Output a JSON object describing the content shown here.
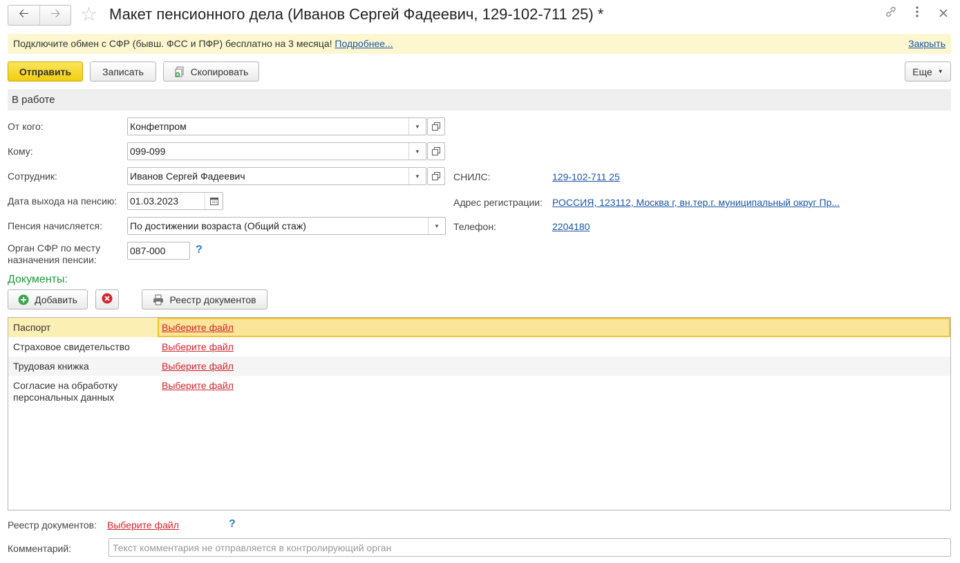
{
  "window": {
    "title": "Макет пенсионного дела (Иванов Сергей Фадеевич, 129-102-711 25) *",
    "back_icon": "arrow-left",
    "forward_icon": "arrow-right",
    "favorite_icon": "star",
    "link_icon": "link",
    "more_icon": "vertical-dots",
    "close_icon": "close"
  },
  "banner": {
    "text": "Подключите обмен с СФР (бывш. ФСС и ПФР) бесплатно на 3 месяца!",
    "more_link": "Подробнее...",
    "close_link": "Закрыть",
    "background": "#fcf7cf"
  },
  "toolbar": {
    "send_label": "Отправить",
    "save_label": "Записать",
    "copy_label": "Скопировать",
    "more_label": "Еще"
  },
  "status": "В работе",
  "form": {
    "from_label": "От кого:",
    "from_value": "Конфетпром",
    "to_label": "Кому:",
    "to_value": "099-099",
    "employee_label": "Сотрудник:",
    "employee_value": "Иванов Сергей Фадеевич",
    "retire_date_label": "Дата выхода на пенсию:",
    "retire_date_value": "01.03.2023",
    "pension_label": "Пенсия начисляется:",
    "pension_value": "По достижении возраста (Общий стаж)",
    "sfr_label_1": "Орган СФР по месту",
    "sfr_label_2": "назначения пенсии:",
    "sfr_value": "087-000",
    "snils_label": "СНИЛС:",
    "snils_value": "129-102-711 25",
    "address_label": "Адрес регистрации:",
    "address_value": "РОССИЯ, 123112, Москва г, вн.тер.г. муниципальный округ Пр...",
    "phone_label": "Телефон:",
    "phone_value": "2204180",
    "help_mark": "?"
  },
  "documents": {
    "title": "Документы:",
    "add_label": "Добавить",
    "registry_button_label": "Реестр документов",
    "rows": [
      {
        "name": "Паспорт",
        "file": "Выберите файл"
      },
      {
        "name": "Страховое свидетельство",
        "file": "Выберите файл"
      },
      {
        "name": "Трудовая книжка",
        "file": "Выберите файл"
      },
      {
        "name_line1": "Согласие на обработку",
        "name_line2": "персональных данных",
        "file": "Выберите файл"
      }
    ]
  },
  "registry": {
    "label": "Реестр документов:",
    "file": "Выберите файл",
    "help_mark": "?"
  },
  "comment": {
    "label": "Комментарий:",
    "placeholder": "Текст комментария не отправляется в контролирующий орган"
  },
  "colors": {
    "accent_yellow": "#f2cd0f",
    "section_green": "#1e9b3d",
    "link_blue": "#1a56a8",
    "link_red": "#d8232a",
    "selected_row": "#fbe599"
  }
}
